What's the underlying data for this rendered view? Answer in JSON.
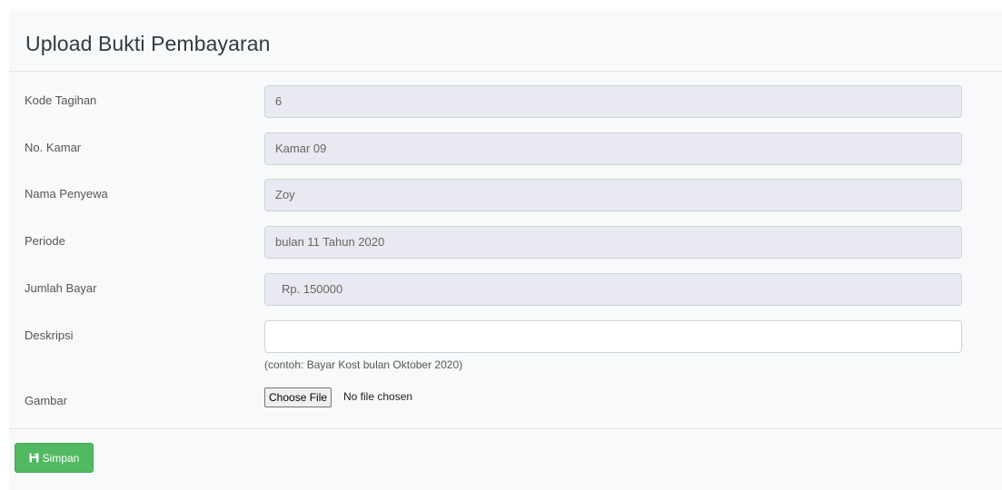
{
  "card": {
    "title": "Upload Bukti Pembayaran"
  },
  "form": {
    "kode_tagihan": {
      "label": "Kode Tagihan",
      "value": "6"
    },
    "no_kamar": {
      "label": "No. Kamar",
      "value": "Kamar 09"
    },
    "nama_penyewa": {
      "label": "Nama Penyewa",
      "value": "Zoy"
    },
    "periode": {
      "label": "Periode",
      "value": "bulan 11 Tahun 2020"
    },
    "jumlah_bayar": {
      "label": "Jumlah Bayar",
      "value": "Rp. 150000"
    },
    "deskripsi": {
      "label": "Deskripsi",
      "value": "",
      "help": "(contoh: Bayar Kost bulan Oktober 2020)"
    },
    "gambar": {
      "label": "Gambar",
      "button_label": "Choose File",
      "status": "No file chosen"
    }
  },
  "actions": {
    "save_label": "Simpan",
    "save_icon": "floppy-disk-icon",
    "save_color": "#51b962"
  }
}
